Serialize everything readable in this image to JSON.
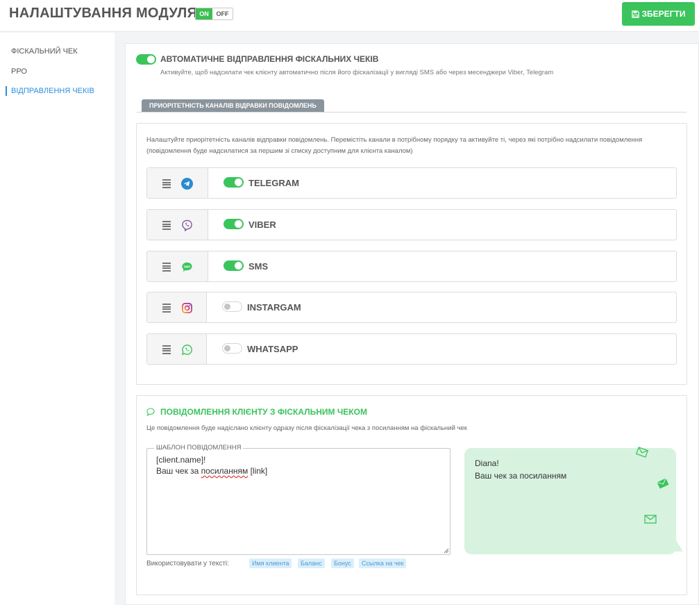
{
  "header": {
    "title": "НАЛАШТУВАННЯ МОДУЛЯ",
    "toggle_on": "ON",
    "toggle_off": "OFF",
    "save_label": "ЗБЕРЕГТИ"
  },
  "sidebar": {
    "items": [
      {
        "label": "ФІСКАЛЬНИЙ ЧЕК"
      },
      {
        "label": "РРО"
      },
      {
        "label": "ВІДПРАВЛЕННЯ ЧЕКІВ",
        "active": true
      }
    ]
  },
  "auto_send": {
    "enabled": true,
    "title": "АВТОМАТИЧНЕ ВІДПРАВЛЕННЯ ФІСКАЛЬНИХ ЧЕКІВ",
    "description": "Активуйте, щоб надсилати чек клієнту автоматично після його фіскалізації у вигляді SMS або через месенджери Viber, Telegram"
  },
  "priority": {
    "tab_label": "ПРИОРІТЕТНІСТЬ КАНАЛІВ ВІДРАВКИ ПОВІДОМЛЕНЬ",
    "description": "Налаштуйте приорітетність каналів відправки повідомлень. Перемістіть канали в потрібному порядку та активуйте ті, через які потрібно надсилати повідомлення (повідомлення буде надсилатися за першим зі списку доступним для клієнта каналом)",
    "channels": [
      {
        "label": "TELEGRAM",
        "enabled": true,
        "icon": "telegram-icon"
      },
      {
        "label": "VIBER",
        "enabled": true,
        "icon": "viber-icon"
      },
      {
        "label": "SMS",
        "enabled": true,
        "icon": "sms-icon"
      },
      {
        "label": "INSTARGAM",
        "enabled": false,
        "icon": "instagram-icon"
      },
      {
        "label": "WHATSAPP",
        "enabled": false,
        "icon": "whatsapp-icon"
      }
    ]
  },
  "message": {
    "title": "ПОВІДОМЛЕННЯ КЛІЄНТУ З ФІСКАЛЬНИМ ЧЕКОМ",
    "description": "Це повідомлення буде надіслано клієнту одразу після фіскалізації чека з посиланням на фіскальний чек",
    "template_legend": "ШАБЛОН ПОВІДОМЛЕННЯ",
    "template_line1": "[client.name]!",
    "template_line2_prefix": "Ваш чек за ",
    "template_line2_word": "посиланням",
    "template_line2_suffix": " [link]",
    "use_in_text_label": "Використовувати у тексті:",
    "chips": [
      "Имя клиента",
      "Баланс",
      "Бонус",
      "Ссылка на чек"
    ],
    "preview_line1": "Diana!",
    "preview_line2": "Ваш чек за посиланням"
  },
  "colors": {
    "accent_green": "#3bc45c",
    "link_blue": "#2b8fd9",
    "bubble_bg": "#d8f2e0"
  }
}
